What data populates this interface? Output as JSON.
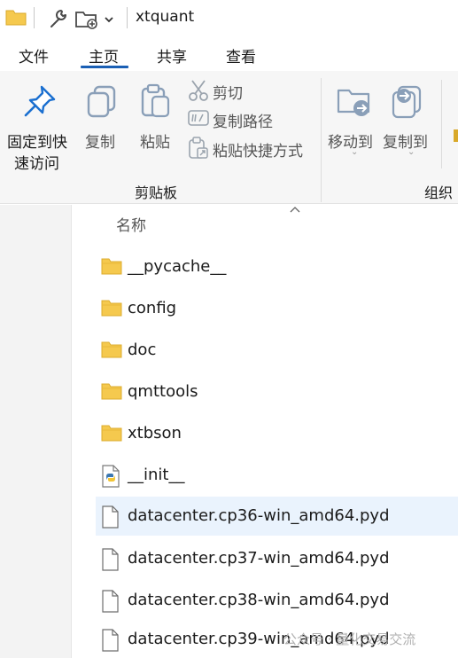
{
  "window": {
    "title": "xtquant"
  },
  "menu": {
    "tabs": [
      "文件",
      "主页",
      "共享",
      "查看"
    ],
    "active": "主页"
  },
  "ribbon": {
    "pin_label_line1": "固定到快",
    "pin_label_line2": "速访问",
    "copy_label": "复制",
    "paste_label": "粘贴",
    "cut_label": "剪切",
    "copy_path_label": "复制路径",
    "paste_shortcut_label": "粘贴快捷方式",
    "clipboard_group": "剪贴板",
    "move_to_label": "移动到",
    "copy_to_label": "复制到",
    "organize_group": "组织"
  },
  "list": {
    "column_header": "名称",
    "items": [
      {
        "name": "__pycache__",
        "type": "folder"
      },
      {
        "name": "config",
        "type": "folder"
      },
      {
        "name": "doc",
        "type": "folder"
      },
      {
        "name": "qmttools",
        "type": "folder"
      },
      {
        "name": "xtbson",
        "type": "folder"
      },
      {
        "name": "__init__",
        "type": "python-file"
      },
      {
        "name": "datacenter.cp36-win_amd64.pyd",
        "type": "file",
        "selected": true
      },
      {
        "name": "datacenter.cp37-win_amd64.pyd",
        "type": "file"
      },
      {
        "name": "datacenter.cp38-win_amd64.pyd",
        "type": "file"
      },
      {
        "name": "datacenter.cp39-win_amd64.pyd",
        "type": "file"
      }
    ]
  },
  "watermark": {
    "text": "公众号 · 量化交易交流"
  },
  "colors": {
    "accent": "#1a5fb4",
    "folder": "#f5c94e",
    "selection": "#eaf3fd"
  }
}
